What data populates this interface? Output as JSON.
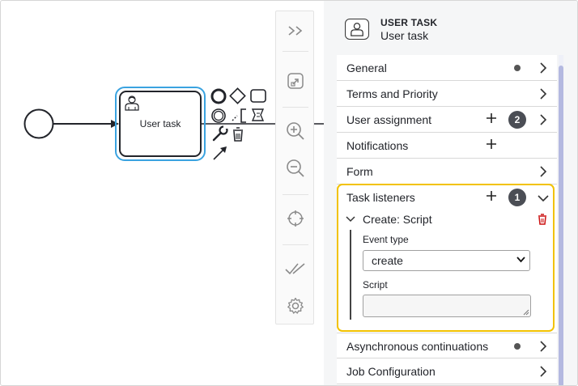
{
  "canvas": {
    "task_label": "User task"
  },
  "palette": {
    "items": [
      {
        "icon": "double-chevron-right-icon"
      },
      {
        "icon": "fit-viewport-icon"
      },
      {
        "icon": "zoom-in-icon"
      },
      {
        "icon": "zoom-out-icon"
      },
      {
        "icon": "crosshair-icon"
      },
      {
        "icon": "validate-checks-icon"
      },
      {
        "icon": "gear-icon"
      }
    ]
  },
  "panel": {
    "header": {
      "type": "USER TASK",
      "name": "User task",
      "icon": "user-task-icon"
    },
    "groups": [
      {
        "label": "General",
        "dot": true
      },
      {
        "label": "Terms and Priority"
      },
      {
        "label": "User assignment",
        "add": true,
        "badge": "2"
      },
      {
        "label": "Notifications",
        "add": true
      },
      {
        "label": "Form"
      },
      {
        "label": "Task listeners",
        "add": true,
        "badge": "1",
        "expanded": true
      },
      {
        "label": "Asynchronous continuations",
        "dot": true
      },
      {
        "label": "Job Configuration"
      }
    ],
    "task_listener": {
      "entry_title": "Create: Script",
      "event_type_label": "Event type",
      "event_type_value": "create",
      "script_label": "Script",
      "script_value": ""
    }
  },
  "colors": {
    "selection": "#3aa3e0",
    "highlight": "#f2c200",
    "badge": "#4b4e55",
    "delete": "#cc1111",
    "scrollbar": "#b4b9e0"
  }
}
